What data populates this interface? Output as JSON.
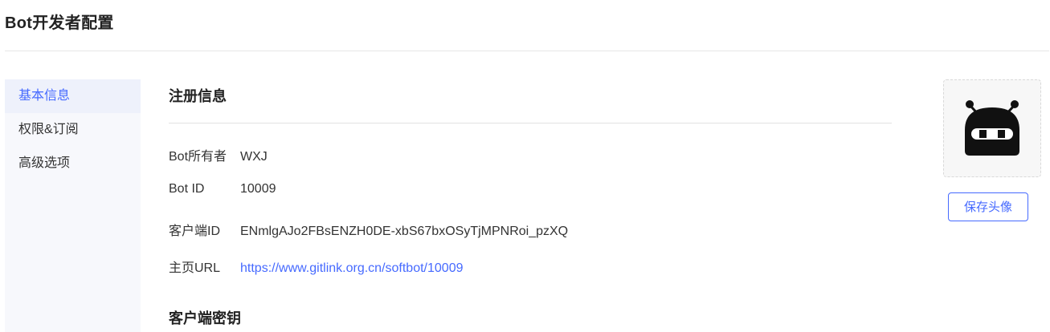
{
  "page": {
    "title": "Bot开发者配置"
  },
  "sidebar": {
    "items": [
      {
        "label": "基本信息",
        "active": true
      },
      {
        "label": "权限&订阅",
        "active": false
      },
      {
        "label": "高级选项",
        "active": false
      }
    ]
  },
  "main": {
    "registration": {
      "title": "注册信息",
      "fields": [
        {
          "label": "Bot所有者",
          "value": "WXJ"
        },
        {
          "label": "Bot ID",
          "value": "10009"
        },
        {
          "label": "客户端ID",
          "value": "ENmlgAJo2FBsENZH0DE-xbS67bxOSyTjMPNRoi_pzXQ"
        },
        {
          "label": "主页URL",
          "value": "https://www.gitlink.org.cn/softbot/10009"
        }
      ]
    },
    "secret": {
      "title": "客户端密钥"
    }
  },
  "avatar": {
    "icon": "robot-icon",
    "save_label": "保存头像"
  },
  "colors": {
    "accent": "#466aff",
    "sidebar_bg": "#f7f8fc",
    "sidebar_active_bg": "#eef1fb"
  }
}
